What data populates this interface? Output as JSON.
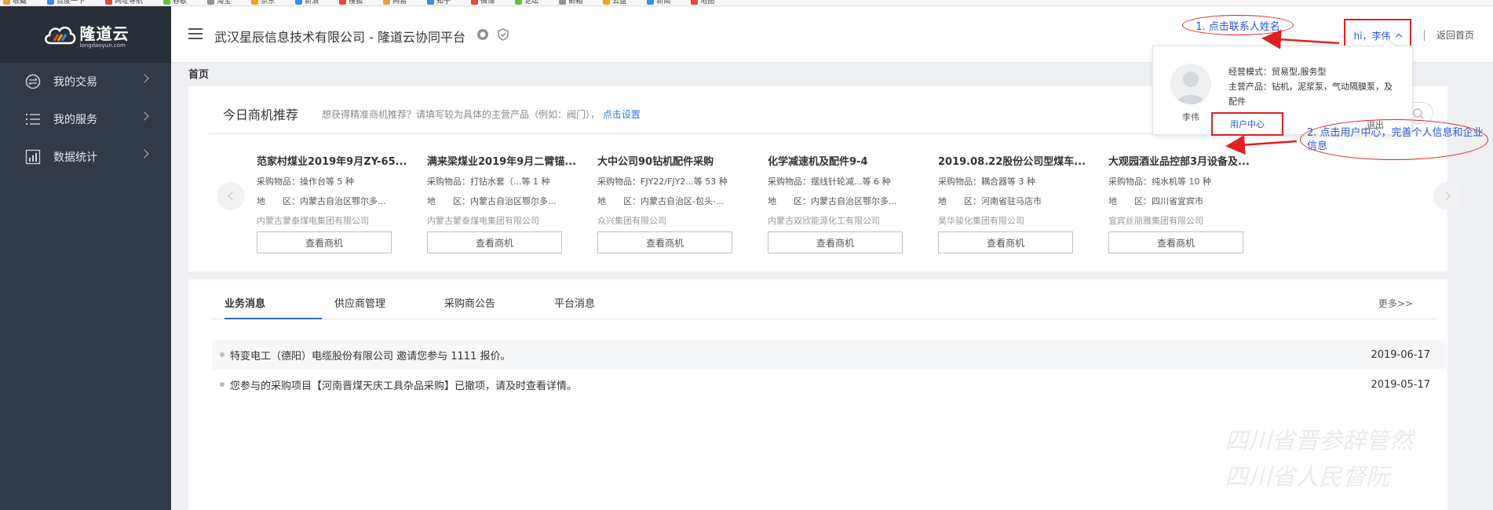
{
  "bookmarks": [
    "收藏",
    "百度一下",
    "网址导航",
    "谷歌",
    "淘宝",
    "京东",
    "新浪",
    "搜狐",
    "网易",
    "知乎",
    "微博",
    "论坛",
    "邮箱",
    "云盘",
    "新闻",
    "地图"
  ],
  "sidebar": {
    "brand": "隆道云",
    "brand_url": "longdaoyun.com",
    "items": [
      {
        "label": "我的交易"
      },
      {
        "label": "我的服务"
      },
      {
        "label": "数据统计"
      }
    ]
  },
  "header": {
    "company": "武汉星辰信息技术有限公司 - 隆道云协同平台",
    "user_greeting": "hi，李伟",
    "home_link": "返回首页"
  },
  "breadcrumb": "首页",
  "recommend": {
    "title": "今日商机推荐",
    "hint": "想获得精准商机推荐？请填写较为具体的主营产品（例如：阀门），",
    "hint_link": "点击设置",
    "cards": [
      {
        "title": "范家村煤业2019年9月ZY-65...",
        "items": "采购物品：操作台等 5 种",
        "area": "地　　区：内蒙古自治区鄂尔多...",
        "company": "内蒙古蒙泰煤电集团有限公司",
        "button": "查看商机"
      },
      {
        "title": "满来梁煤业2019年9月二臂锚...",
        "items": "采购物品：打钻水套（...等 1 种",
        "area": "地　　区：内蒙古自治区鄂尔多...",
        "company": "内蒙古蒙泰煤电集团有限公司",
        "button": "查看商机"
      },
      {
        "title": "大中公司90钻机配件采购",
        "items": "采购物品：FJY22/FJY2...等 53 种",
        "area": "地　　区：内蒙古自治区-包头-...",
        "company": "众兴集团有限公司",
        "button": "查看商机"
      },
      {
        "title": "化学减速机及配件9-4",
        "items": "采购物品：摆线针轮减...等 6 种",
        "area": "地　　区：内蒙古自治区鄂尔多...",
        "company": "内蒙古双欣能源化工有限公司",
        "button": "查看商机"
      },
      {
        "title": "2019.08.22股份公司型煤车...",
        "items": "采购物品：耦合器等 3 种",
        "area": "地　　区：河南省驻马店市",
        "company": "昊华骏化集团有限公司",
        "button": "查看商机"
      },
      {
        "title": "大观园酒业品控部3月设备及...",
        "items": "采购物品：纯水机等 10 种",
        "area": "地　　区：四川省宜宾市",
        "company": "宜宾丝丽雅集团有限公司",
        "button": "查看商机"
      }
    ]
  },
  "messages": {
    "tabs": [
      "业务消息",
      "供应商管理",
      "采购商公告",
      "平台消息"
    ],
    "more": "更多>>",
    "rows": [
      {
        "text": "特变电工（德阳）电缆股份有限公司 邀请您参与 1111 报价。",
        "date": "2019-06-17"
      },
      {
        "text": "您参与的采购项目【河南晋煤天庆工具杂品采购】已撤项，请及时查看详情。",
        "date": "2019-05-17"
      }
    ]
  },
  "dropdown": {
    "name": "李伟",
    "mode": "经营模式：贸易型,服务型",
    "products": "主营产品：钻机，泥浆泵，气动隔膜泵，及配件",
    "user_center": "用户中心",
    "logout": "退出"
  },
  "annotations": {
    "step1": "1. 点击联系人姓名",
    "step2": "2. 点击用户中心，完善个人信息和企业信息"
  },
  "watermark": [
    "四川省晋参辞管然",
    "四川省人民督阮"
  ],
  "colors": {
    "sidebar": "#323a45",
    "accent_blue": "#2f6fd2",
    "annotation_red": "#e02020",
    "annotation_text": "#2a55d6"
  }
}
